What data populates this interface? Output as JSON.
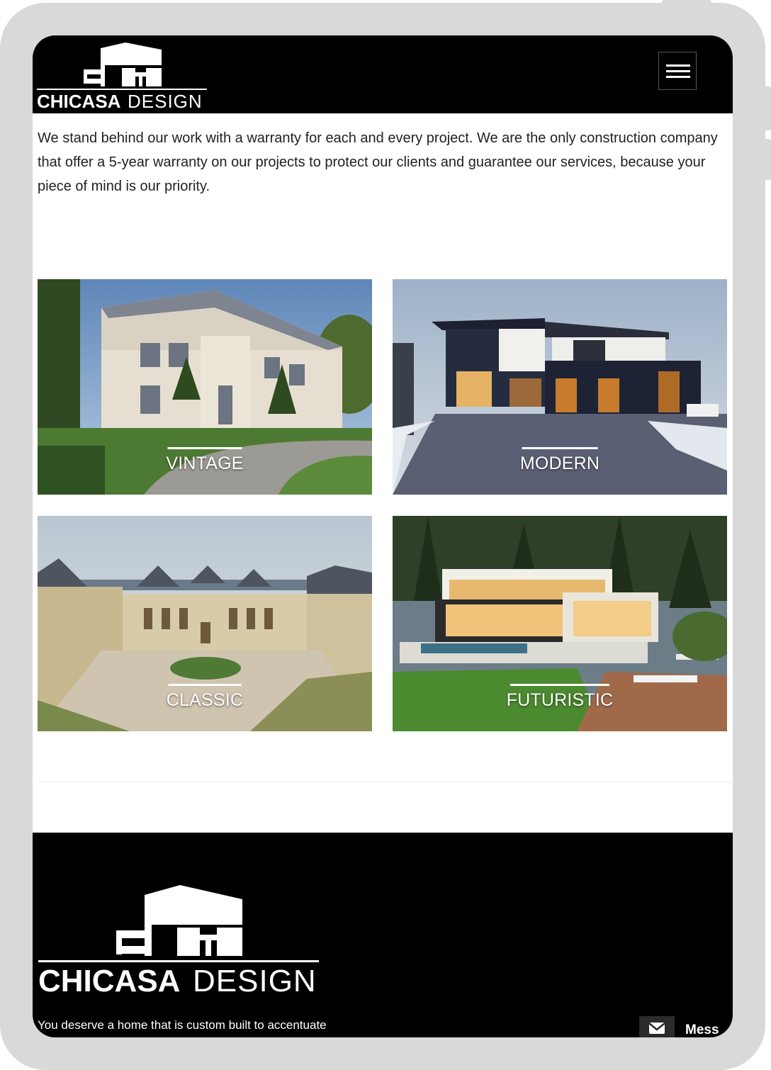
{
  "header": {
    "logo_left": "CHICASA",
    "logo_right": "DESIGN",
    "menu_icon": "hamburger-menu-icon"
  },
  "intro": {
    "text": "We stand behind our work with a warranty for each and every project. We are the only construction company that offer a 5-year warranty on our projects to protect our clients and guarantee our services, because your piece of mind is our priority."
  },
  "gallery": {
    "items": [
      {
        "label": "VINTAGE"
      },
      {
        "label": "MODERN"
      },
      {
        "label": "CLASSIC"
      },
      {
        "label": "FUTURISTIC"
      }
    ]
  },
  "footer": {
    "logo_left": "CHICASA",
    "logo_right": "DESIGN",
    "tagline": "You deserve a home that is custom built to accentuate",
    "message_label": "Mess",
    "message_icon": "envelope-icon"
  },
  "colors": {
    "header_bg": "#000000",
    "footer_bg": "#000000",
    "frame": "#d9d9d9",
    "text": "#222222"
  }
}
